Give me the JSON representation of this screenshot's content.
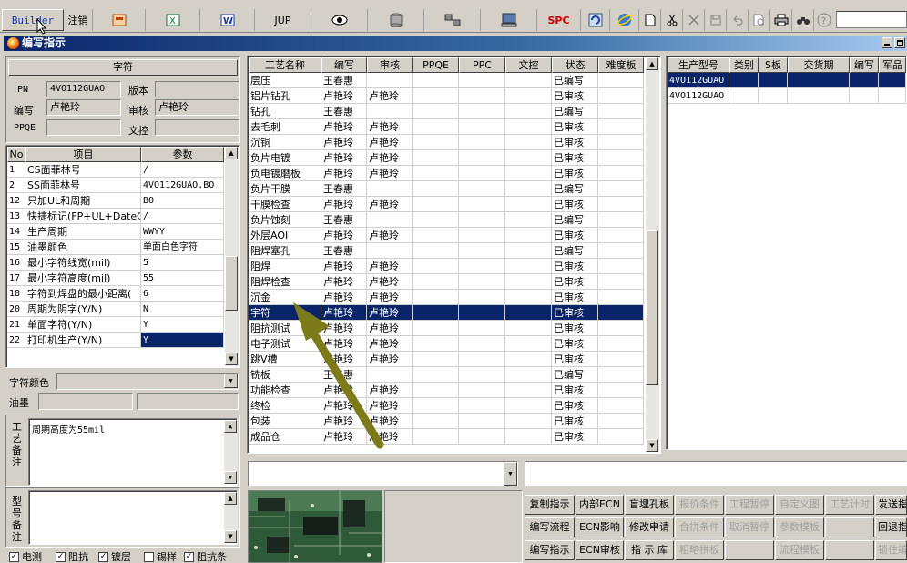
{
  "toolbar": {
    "builder": "Builder",
    "logout": "注销",
    "jup": "JUP",
    "spc": "SPC"
  },
  "window": {
    "title": "编写指示"
  },
  "char_panel": {
    "section_title": "字符",
    "pn_label": "PN",
    "pn_value": "4VO112GUAO",
    "version_label": "版本",
    "version_value": "",
    "writer_label": "编写",
    "writer_value": "卢艳玲",
    "reviewer_label": "审核",
    "reviewer_value": "卢艳玲",
    "ppqe_label": "PPQE",
    "ppqe_value": "",
    "doc_control_label": "文控",
    "doc_control_value": ""
  },
  "param_table": {
    "headers": [
      "No",
      "项目",
      "参数"
    ],
    "rows": [
      {
        "no": "1",
        "item": "CS面菲林号",
        "param": "/"
      },
      {
        "no": "2",
        "item": "SS面菲林号",
        "param": "4VO112GUAO.BO"
      },
      {
        "no": "12",
        "item": "只加UL和周期",
        "param": "BO"
      },
      {
        "no": "13",
        "item": "快捷标记(FP+UL+DateCo",
        "param": "/"
      },
      {
        "no": "14",
        "item": "生产周期",
        "param": "WWYY"
      },
      {
        "no": "15",
        "item": "油墨颜色",
        "param": "单面白色字符"
      },
      {
        "no": "16",
        "item": "最小字符线宽(mil)",
        "param": "5"
      },
      {
        "no": "17",
        "item": "最小字符高度(mil)",
        "param": "55"
      },
      {
        "no": "18",
        "item": "字符到焊盘的最小距离(",
        "param": "6"
      },
      {
        "no": "20",
        "item": "周期为阴字(Y/N)",
        "param": "N"
      },
      {
        "no": "21",
        "item": "单面字符(Y/N)",
        "param": "Y"
      },
      {
        "no": "22",
        "item": "打印机生产(Y/N)",
        "param": "Y"
      }
    ]
  },
  "bottom_left": {
    "char_color_label": "字符颜色",
    "ink_label": "油墨",
    "process_note_label": "工艺备注",
    "process_note_value": "周期高度为55mil",
    "model_note_label": "型号备注",
    "checkboxes": [
      {
        "label": "电测",
        "checked": true
      },
      {
        "label": "阻抗",
        "checked": true
      },
      {
        "label": "镀层",
        "checked": true
      },
      {
        "label": "锡样",
        "checked": false
      },
      {
        "label": "阻抗条",
        "checked": true
      }
    ]
  },
  "process_table": {
    "headers": [
      "工艺名称",
      "编写",
      "审核",
      "PPQE",
      "PPC",
      "文控",
      "状态",
      "难度板"
    ],
    "selected_index": 15,
    "rows": [
      {
        "name": "层压",
        "writer": "王春惠",
        "reviewer": "",
        "status": "已编写"
      },
      {
        "name": "铝片钻孔",
        "writer": "卢艳玲",
        "reviewer": "卢艳玲",
        "status": "已审核"
      },
      {
        "name": "钻孔",
        "writer": "王春惠",
        "reviewer": "",
        "status": "已编写"
      },
      {
        "name": "去毛刺",
        "writer": "卢艳玲",
        "reviewer": "卢艳玲",
        "status": "已审核"
      },
      {
        "name": "沉铜",
        "writer": "卢艳玲",
        "reviewer": "卢艳玲",
        "status": "已审核"
      },
      {
        "name": "负片电镀",
        "writer": "卢艳玲",
        "reviewer": "卢艳玲",
        "status": "已审核"
      },
      {
        "name": "负电镀磨板",
        "writer": "卢艳玲",
        "reviewer": "卢艳玲",
        "status": "已审核"
      },
      {
        "name": "负片干膜",
        "writer": "王春惠",
        "reviewer": "",
        "status": "已编写"
      },
      {
        "name": "干膜检查",
        "writer": "卢艳玲",
        "reviewer": "卢艳玲",
        "status": "已审核"
      },
      {
        "name": "负片蚀刻",
        "writer": "王春惠",
        "reviewer": "",
        "status": "已编写"
      },
      {
        "name": "外层AOI",
        "writer": "卢艳玲",
        "reviewer": "卢艳玲",
        "status": "已审核"
      },
      {
        "name": "阻焊塞孔",
        "writer": "王春惠",
        "reviewer": "",
        "status": "已编写"
      },
      {
        "name": "阻焊",
        "writer": "卢艳玲",
        "reviewer": "卢艳玲",
        "status": "已审核"
      },
      {
        "name": "阻焊检查",
        "writer": "卢艳玲",
        "reviewer": "卢艳玲",
        "status": "已审核"
      },
      {
        "name": "沉金",
        "writer": "卢艳玲",
        "reviewer": "卢艳玲",
        "status": "已审核"
      },
      {
        "name": "字符",
        "writer": "卢艳玲",
        "reviewer": "卢艳玲",
        "status": "已审核"
      },
      {
        "name": "阻抗测试",
        "writer": "卢艳玲",
        "reviewer": "卢艳玲",
        "status": "已审核"
      },
      {
        "name": "电子测试",
        "writer": "卢艳玲",
        "reviewer": "卢艳玲",
        "status": "已审核"
      },
      {
        "name": "跳V槽",
        "writer": "卢艳玲",
        "reviewer": "卢艳玲",
        "status": "已审核"
      },
      {
        "name": "铣板",
        "writer": "王春惠",
        "reviewer": "",
        "status": "已编写"
      },
      {
        "name": "功能检查",
        "writer": "卢艳玲",
        "reviewer": "卢艳玲",
        "status": "已审核"
      },
      {
        "name": "终检",
        "writer": "卢艳玲",
        "reviewer": "卢艳玲",
        "status": "已审核"
      },
      {
        "name": "包装",
        "writer": "卢艳玲",
        "reviewer": "卢艳玲",
        "status": "已审核"
      },
      {
        "name": "成品仓",
        "writer": "卢艳玲",
        "reviewer": "卢艳玲",
        "status": "已审核"
      }
    ]
  },
  "model_table": {
    "headers": [
      "生产型号",
      "类别",
      "S板",
      "交货期",
      "编写",
      "军品"
    ],
    "rows": [
      {
        "model": "4VO112GUAO",
        "selected": true
      },
      {
        "model": "4VO112GUAO",
        "selected": false
      }
    ]
  },
  "buttons": {
    "row1": [
      "复制指示",
      "内部ECN",
      "盲埋孔板",
      "报价条件",
      "工程暂停",
      "自定义图",
      "工艺计时",
      "发送指"
    ],
    "row2": [
      "编写流程",
      "ECN影响",
      "修改申请",
      "合拼条件",
      "取消暂停",
      "参数模板",
      "",
      "回退指"
    ],
    "row3": [
      "编写指示",
      "ECN审核",
      "指 示 库",
      "粗略拼板",
      "",
      "流程模板",
      "",
      "锁住编"
    ],
    "disabled": [
      "报价条件",
      "工程暂停",
      "自定义图",
      "工艺计时",
      "合拼条件",
      "取消暂停",
      "参数模板",
      "粗略拼板",
      "流程模板",
      "锁住编"
    ]
  },
  "colors": {
    "selection": "#0a246a",
    "title_gradient_start": "#0a246a",
    "title_gradient_end": "#a6caf0",
    "annotation_arrow": "#7d7a1a"
  }
}
